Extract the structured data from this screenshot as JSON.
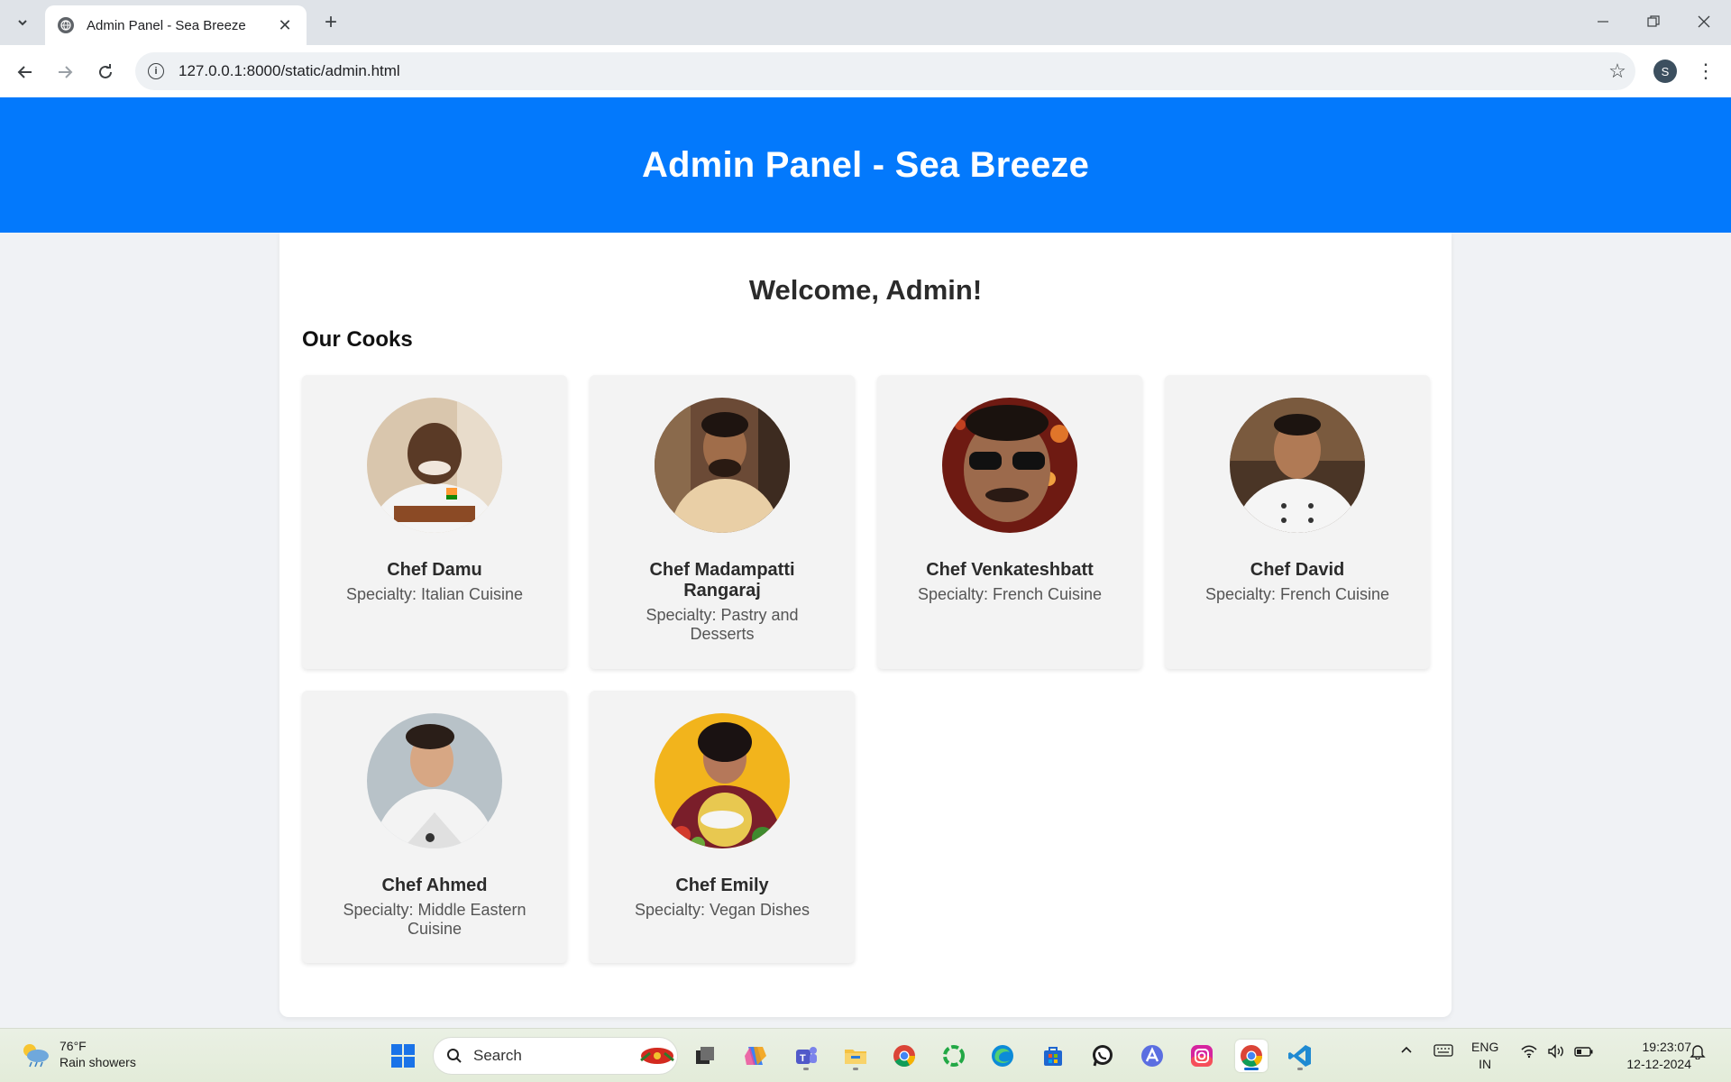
{
  "browser": {
    "tab_title": "Admin Panel - Sea Breeze",
    "url": "127.0.0.1:8000/static/admin.html",
    "profile_initial": "S"
  },
  "page": {
    "header_title": "Admin Panel - Sea Breeze",
    "welcome": "Welcome, Admin!",
    "section_title": "Our Cooks",
    "cooks": [
      {
        "name": "Chef Damu",
        "specialty": "Specialty: Italian Cuisine"
      },
      {
        "name": "Chef Madampatti Rangaraj",
        "specialty": "Specialty: Pastry and Desserts"
      },
      {
        "name": "Chef Venkateshbatt",
        "specialty": "Specialty: French Cuisine"
      },
      {
        "name": "Chef David",
        "specialty": "Specialty: French Cuisine"
      },
      {
        "name": "Chef Ahmed",
        "specialty": "Specialty: Middle Eastern Cuisine"
      },
      {
        "name": "Chef Emily",
        "specialty": "Specialty: Vegan Dishes"
      }
    ]
  },
  "taskbar": {
    "weather_temp": "76°F",
    "weather_condition": "Rain showers",
    "search_placeholder": "Search",
    "lang_line1": "ENG",
    "lang_line2": "IN",
    "time": "19:23:07",
    "date": "12-12-2024"
  },
  "colors": {
    "header_blue": "#0379fc",
    "card_bg": "#f3f3f3",
    "page_bg": "#f0f2f5"
  }
}
